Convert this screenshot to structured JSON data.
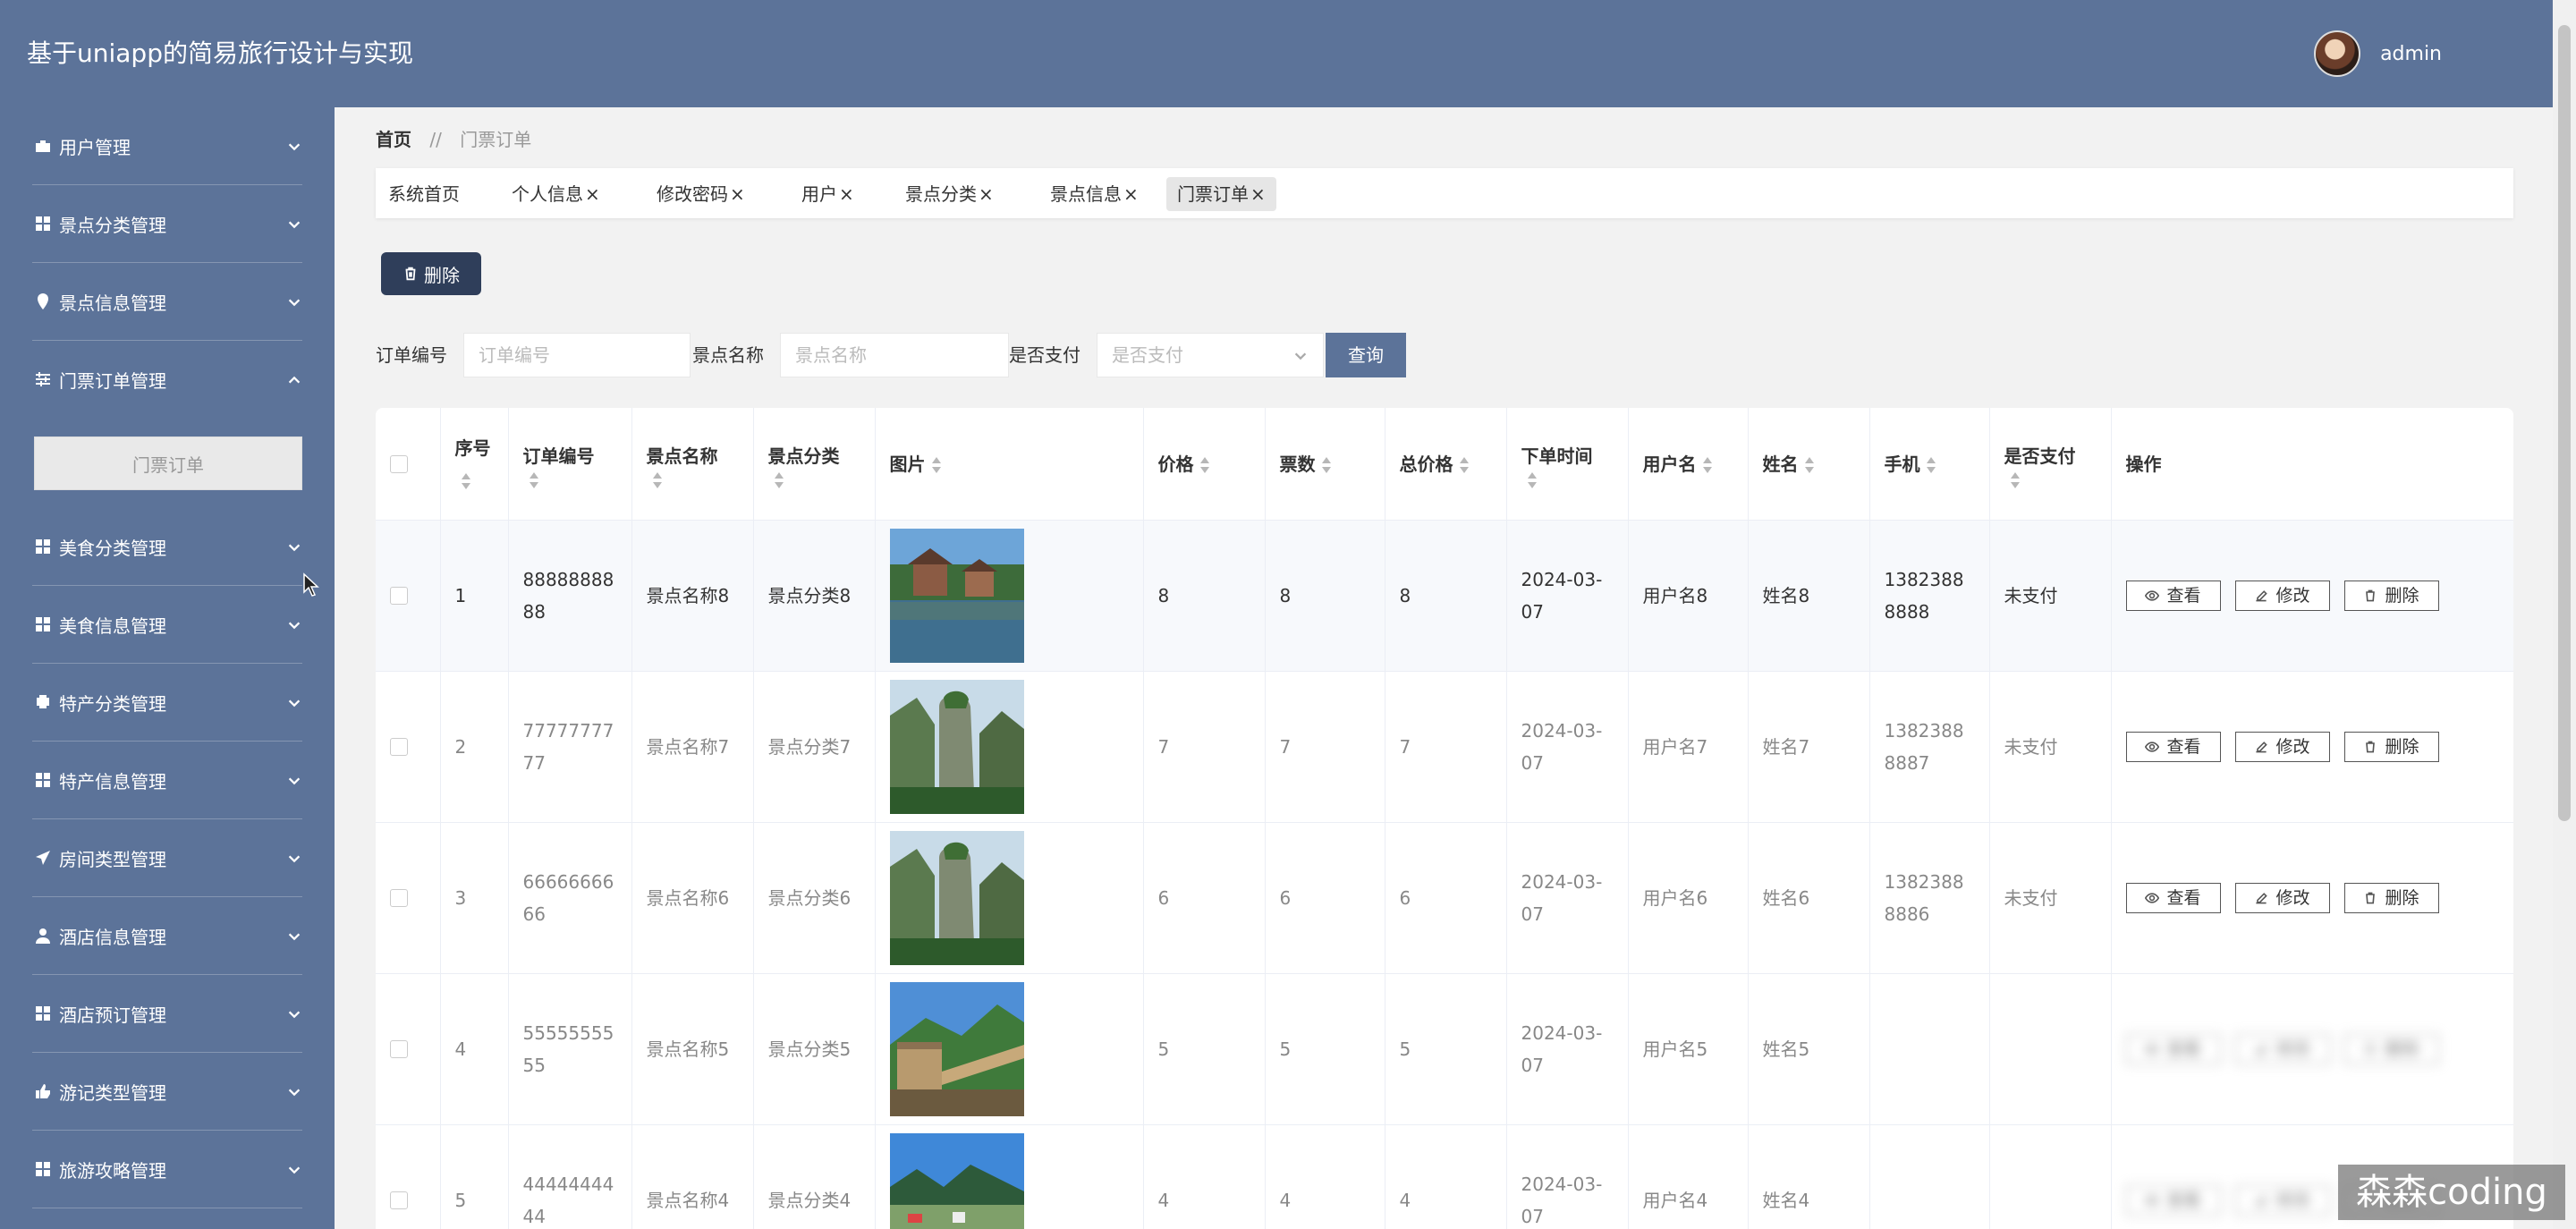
{
  "app": {
    "title": "基于uniapp的简易旅行设计与实现"
  },
  "user": {
    "name": "admin"
  },
  "sidebar": {
    "items": [
      {
        "label": "用户管理",
        "icon": "briefcase-icon"
      },
      {
        "label": "景点分类管理",
        "icon": "grid-icon"
      },
      {
        "label": "景点信息管理",
        "icon": "location-pin-icon"
      },
      {
        "label": "门票订单管理",
        "icon": "sliders-icon",
        "expanded": true,
        "submenu": [
          {
            "label": "门票订单"
          }
        ]
      },
      {
        "label": "美食分类管理",
        "icon": "grid-icon"
      },
      {
        "label": "美食信息管理",
        "icon": "grid-icon"
      },
      {
        "label": "特产分类管理",
        "icon": "printer-icon"
      },
      {
        "label": "特产信息管理",
        "icon": "grid-icon"
      },
      {
        "label": "房间类型管理",
        "icon": "paper-plane-icon"
      },
      {
        "label": "酒店信息管理",
        "icon": "user-icon"
      },
      {
        "label": "酒店预订管理",
        "icon": "grid-icon"
      },
      {
        "label": "游记类型管理",
        "icon": "thumbs-up-icon"
      },
      {
        "label": "旅游攻略管理",
        "icon": "grid-icon"
      }
    ]
  },
  "breadcrumb": {
    "home": "首页",
    "separator": "//",
    "current": "门票订单"
  },
  "tabs": [
    {
      "label": "系统首页",
      "closable": false
    },
    {
      "label": "个人信息",
      "closable": true
    },
    {
      "label": "修改密码",
      "closable": true
    },
    {
      "label": "用户",
      "closable": true
    },
    {
      "label": "景点分类",
      "closable": true
    },
    {
      "label": "景点信息",
      "closable": true
    },
    {
      "label": "门票订单",
      "closable": true,
      "active": true
    }
  ],
  "tab_close_glyph": "×",
  "toolbar": {
    "delete_label": "删除"
  },
  "search": {
    "order_no_label": "订单编号",
    "order_no_placeholder": "订单编号",
    "spot_name_label": "景点名称",
    "spot_name_placeholder": "景点名称",
    "paid_label": "是否支付",
    "paid_placeholder": "是否支付",
    "query_label": "查询"
  },
  "table": {
    "columns": [
      "序号",
      "订单编号",
      "景点名称",
      "景点分类",
      "图片",
      "价格",
      "票数",
      "总价格",
      "下单时间",
      "用户名",
      "姓名",
      "手机",
      "是否支付",
      "操作"
    ],
    "actions": {
      "view": "查看",
      "edit": "修改",
      "delete": "删除"
    },
    "rows": [
      {
        "index": "1",
        "order_no": "8888888888",
        "spot_name": "景点名称8",
        "spot_category": "景点分类8",
        "image": "chinese-pavilion-by-lake",
        "price": "8",
        "tickets": "8",
        "total": "8",
        "order_time": "2024-03-07",
        "username": "用户名8",
        "name": "姓名8",
        "phone": "13823888888",
        "paid": "未支付"
      },
      {
        "index": "2",
        "order_no": "7777777777",
        "spot_name": "景点名称7",
        "spot_category": "景点分类7",
        "image": "karst-pillar-mountain",
        "price": "7",
        "tickets": "7",
        "total": "7",
        "order_time": "2024-03-07",
        "username": "用户名7",
        "name": "姓名7",
        "phone": "13823888887",
        "paid": "未支付"
      },
      {
        "index": "3",
        "order_no": "6666666666",
        "spot_name": "景点名称6",
        "spot_category": "景点分类6",
        "image": "karst-pillar-mountain",
        "price": "6",
        "tickets": "6",
        "total": "6",
        "order_time": "2024-03-07",
        "username": "用户名6",
        "name": "姓名6",
        "phone": "13823888886",
        "paid": "未支付"
      },
      {
        "index": "4",
        "order_no": "5555555555",
        "spot_name": "景点名称5",
        "spot_category": "景点分类5",
        "image": "great-wall",
        "price": "5",
        "tickets": "5",
        "total": "5",
        "order_time": "2024-03-07",
        "username": "用户名5",
        "name": "姓名5",
        "phone": "",
        "paid": ""
      },
      {
        "index": "5",
        "order_no": "4444444444",
        "spot_name": "景点名称4",
        "spot_category": "景点分类4",
        "image": "lakeside-village",
        "price": "4",
        "tickets": "4",
        "total": "4",
        "order_time": "2024-03-07",
        "username": "用户名4",
        "name": "姓名4",
        "phone": "",
        "paid": ""
      }
    ]
  },
  "watermark": "森森coding"
}
